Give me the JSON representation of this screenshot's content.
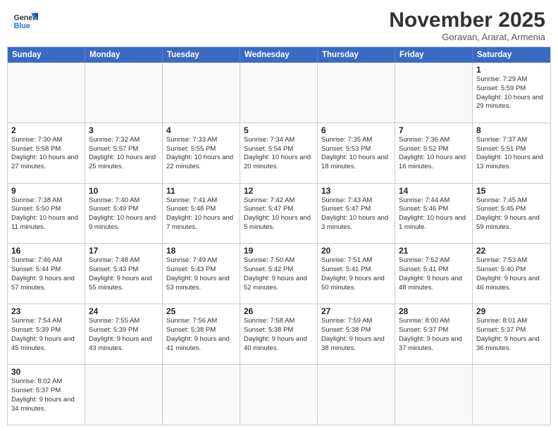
{
  "header": {
    "logo_general": "General",
    "logo_blue": "Blue",
    "month_title": "November 2025",
    "subtitle": "Goravan, Ararat, Armenia"
  },
  "days_of_week": [
    "Sunday",
    "Monday",
    "Tuesday",
    "Wednesday",
    "Thursday",
    "Friday",
    "Saturday"
  ],
  "weeks": [
    [
      {
        "day": "",
        "info": "",
        "empty": true
      },
      {
        "day": "",
        "info": "",
        "empty": true
      },
      {
        "day": "",
        "info": "",
        "empty": true
      },
      {
        "day": "",
        "info": "",
        "empty": true
      },
      {
        "day": "",
        "info": "",
        "empty": true
      },
      {
        "day": "",
        "info": "",
        "empty": true
      },
      {
        "day": "1",
        "info": "Sunrise: 7:29 AM\nSunset: 5:59 PM\nDaylight: 10 hours and 29 minutes."
      }
    ],
    [
      {
        "day": "2",
        "info": "Sunrise: 7:30 AM\nSunset: 5:58 PM\nDaylight: 10 hours and 27 minutes."
      },
      {
        "day": "3",
        "info": "Sunrise: 7:32 AM\nSunset: 5:57 PM\nDaylight: 10 hours and 25 minutes."
      },
      {
        "day": "4",
        "info": "Sunrise: 7:33 AM\nSunset: 5:55 PM\nDaylight: 10 hours and 22 minutes."
      },
      {
        "day": "5",
        "info": "Sunrise: 7:34 AM\nSunset: 5:54 PM\nDaylight: 10 hours and 20 minutes."
      },
      {
        "day": "6",
        "info": "Sunrise: 7:35 AM\nSunset: 5:53 PM\nDaylight: 10 hours and 18 minutes."
      },
      {
        "day": "7",
        "info": "Sunrise: 7:36 AM\nSunset: 5:52 PM\nDaylight: 10 hours and 16 minutes."
      },
      {
        "day": "8",
        "info": "Sunrise: 7:37 AM\nSunset: 5:51 PM\nDaylight: 10 hours and 13 minutes."
      }
    ],
    [
      {
        "day": "9",
        "info": "Sunrise: 7:38 AM\nSunset: 5:50 PM\nDaylight: 10 hours and 11 minutes."
      },
      {
        "day": "10",
        "info": "Sunrise: 7:40 AM\nSunset: 5:49 PM\nDaylight: 10 hours and 9 minutes."
      },
      {
        "day": "11",
        "info": "Sunrise: 7:41 AM\nSunset: 5:48 PM\nDaylight: 10 hours and 7 minutes."
      },
      {
        "day": "12",
        "info": "Sunrise: 7:42 AM\nSunset: 5:47 PM\nDaylight: 10 hours and 5 minutes."
      },
      {
        "day": "13",
        "info": "Sunrise: 7:43 AM\nSunset: 5:47 PM\nDaylight: 10 hours and 3 minutes."
      },
      {
        "day": "14",
        "info": "Sunrise: 7:44 AM\nSunset: 5:46 PM\nDaylight: 10 hours and 1 minute."
      },
      {
        "day": "15",
        "info": "Sunrise: 7:45 AM\nSunset: 5:45 PM\nDaylight: 9 hours and 59 minutes."
      }
    ],
    [
      {
        "day": "16",
        "info": "Sunrise: 7:46 AM\nSunset: 5:44 PM\nDaylight: 9 hours and 57 minutes."
      },
      {
        "day": "17",
        "info": "Sunrise: 7:48 AM\nSunset: 5:43 PM\nDaylight: 9 hours and 55 minutes."
      },
      {
        "day": "18",
        "info": "Sunrise: 7:49 AM\nSunset: 5:43 PM\nDaylight: 9 hours and 53 minutes."
      },
      {
        "day": "19",
        "info": "Sunrise: 7:50 AM\nSunset: 5:42 PM\nDaylight: 9 hours and 52 minutes."
      },
      {
        "day": "20",
        "info": "Sunrise: 7:51 AM\nSunset: 5:41 PM\nDaylight: 9 hours and 50 minutes."
      },
      {
        "day": "21",
        "info": "Sunrise: 7:52 AM\nSunset: 5:41 PM\nDaylight: 9 hours and 48 minutes."
      },
      {
        "day": "22",
        "info": "Sunrise: 7:53 AM\nSunset: 5:40 PM\nDaylight: 9 hours and 46 minutes."
      }
    ],
    [
      {
        "day": "23",
        "info": "Sunrise: 7:54 AM\nSunset: 5:39 PM\nDaylight: 9 hours and 45 minutes."
      },
      {
        "day": "24",
        "info": "Sunrise: 7:55 AM\nSunset: 5:39 PM\nDaylight: 9 hours and 43 minutes."
      },
      {
        "day": "25",
        "info": "Sunrise: 7:56 AM\nSunset: 5:38 PM\nDaylight: 9 hours and 41 minutes."
      },
      {
        "day": "26",
        "info": "Sunrise: 7:58 AM\nSunset: 5:38 PM\nDaylight: 9 hours and 40 minutes."
      },
      {
        "day": "27",
        "info": "Sunrise: 7:59 AM\nSunset: 5:38 PM\nDaylight: 9 hours and 38 minutes."
      },
      {
        "day": "28",
        "info": "Sunrise: 8:00 AM\nSunset: 5:37 PM\nDaylight: 9 hours and 37 minutes."
      },
      {
        "day": "29",
        "info": "Sunrise: 8:01 AM\nSunset: 5:37 PM\nDaylight: 9 hours and 36 minutes."
      }
    ],
    [
      {
        "day": "30",
        "info": "Sunrise: 8:02 AM\nSunset: 5:37 PM\nDaylight: 9 hours and 34 minutes."
      },
      {
        "day": "",
        "info": "",
        "empty": true
      },
      {
        "day": "",
        "info": "",
        "empty": true
      },
      {
        "day": "",
        "info": "",
        "empty": true
      },
      {
        "day": "",
        "info": "",
        "empty": true
      },
      {
        "day": "",
        "info": "",
        "empty": true
      },
      {
        "day": "",
        "info": "",
        "empty": true
      }
    ]
  ]
}
